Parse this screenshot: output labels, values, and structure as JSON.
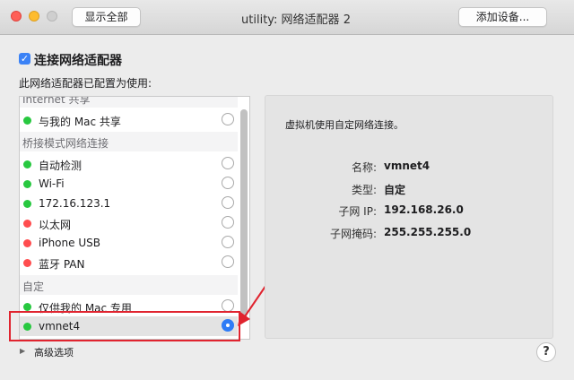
{
  "window": {
    "title": "utility: 网络适配器 2",
    "show_all": "显示全部",
    "add_device": "添加设备..."
  },
  "adapter": {
    "connect_label": "连接网络适配器",
    "connect_checked": true,
    "usage_label": "此网络适配器已配置为使用:"
  },
  "list": {
    "partial_header": "Internet 共享",
    "sections": [
      {
        "header": "桥接模式网络连接"
      },
      {
        "header": "自定"
      }
    ],
    "items": [
      {
        "label": "与我的 Mac 共享",
        "status": "green",
        "selected": false
      },
      {
        "label": "自动检测",
        "status": "green",
        "selected": false
      },
      {
        "label": "Wi-Fi",
        "status": "green",
        "selected": false
      },
      {
        "label": "172.16.123.1",
        "status": "green",
        "selected": false
      },
      {
        "label": "以太网",
        "status": "red",
        "selected": false
      },
      {
        "label": "iPhone USB",
        "status": "red",
        "selected": false
      },
      {
        "label": "蓝牙 PAN",
        "status": "red",
        "selected": false
      },
      {
        "label": "仅供我的 Mac 专用",
        "status": "green",
        "selected": false
      },
      {
        "label": "vmnet4",
        "status": "green",
        "selected": true
      }
    ]
  },
  "details": {
    "description": "虚拟机使用自定网络连接。",
    "rows": [
      {
        "key": "名称:",
        "value": "vmnet4"
      },
      {
        "key": "类型:",
        "value": "自定"
      },
      {
        "key": "子网 IP:",
        "value": "192.168.26.0"
      },
      {
        "key": "子网掩码:",
        "value": "255.255.255.0"
      }
    ]
  },
  "advanced": {
    "label": "高级选项"
  },
  "help": {
    "label": "?"
  },
  "colors": {
    "status_green": "#28c840",
    "status_red": "#ff4d4f",
    "accent_blue": "#2f7cf6",
    "annotation_red": "#e0242f"
  }
}
